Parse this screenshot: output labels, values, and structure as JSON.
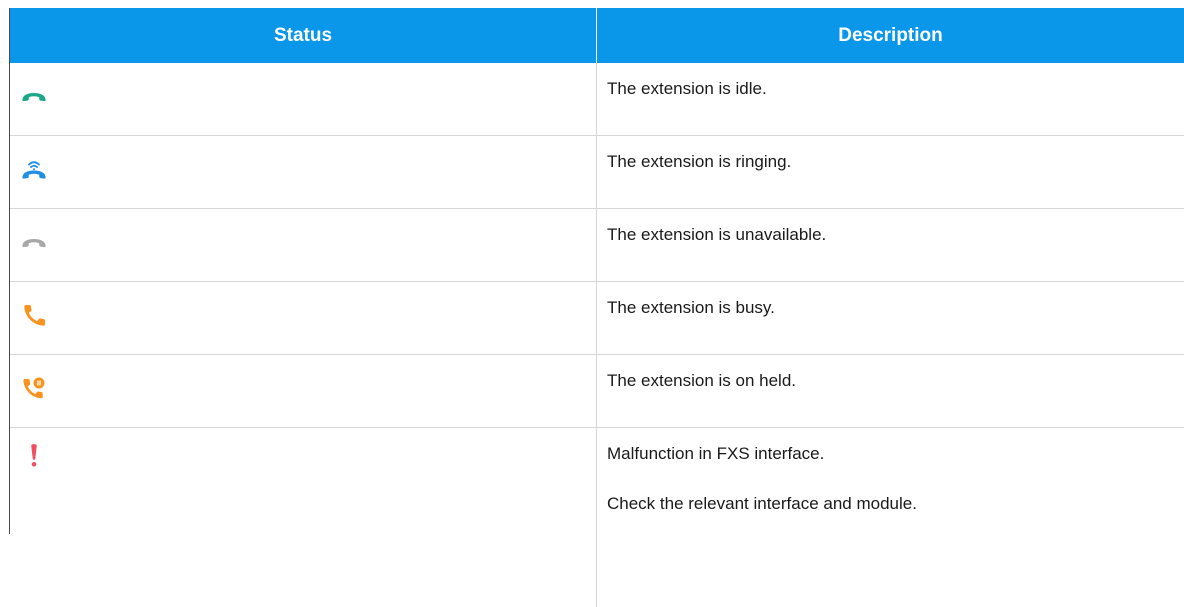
{
  "table": {
    "headers": {
      "status": "Status",
      "description": "Description"
    },
    "rows": [
      {
        "icon": "phone-idle-icon",
        "color": "#1aa889",
        "description": [
          "The extension is idle."
        ]
      },
      {
        "icon": "phone-ringing-icon",
        "color": "#1e8fe6",
        "description": [
          "The extension is ringing."
        ]
      },
      {
        "icon": "phone-unavailable-icon",
        "color": "#a8a8a8",
        "description": [
          "The extension is unavailable."
        ]
      },
      {
        "icon": "phone-busy-icon",
        "color": "#f7931e",
        "description": [
          "The extension is busy."
        ]
      },
      {
        "icon": "phone-held-icon",
        "color": "#f7931e",
        "description": [
          "The extension is on held."
        ]
      },
      {
        "icon": "exclamation-icon",
        "color": "#ef4f5f",
        "description": [
          "Malfunction in FXS interface.",
          "Check the relevant interface and module."
        ]
      }
    ]
  },
  "colors": {
    "header_bg": "#0a97ea",
    "header_text": "#ffffff",
    "grid": "#d6d6d6"
  }
}
